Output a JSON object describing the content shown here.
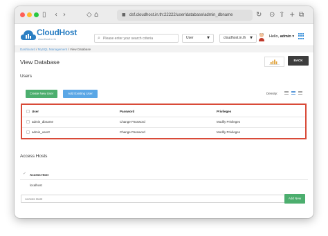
{
  "browser": {
    "url": "dsf.cloudhost.in.th:22222/user/database/admin_dbname",
    "traffic_lights": [
      "close",
      "minimize",
      "zoom"
    ],
    "icons": [
      "sidebar-icon",
      "back-icon",
      "forward-icon",
      "privacy-shield-icon",
      "home-icon",
      "refresh-icon",
      "download-icon",
      "share-icon",
      "new-tab-icon",
      "tabs-overview-icon"
    ]
  },
  "header": {
    "logo_text": "CloudHost",
    "logo_subtext": "cloudhost.in.th",
    "search_placeholder": "Please enter your search criteria",
    "user_select": "User",
    "domain_select": "cloudhost.in.th",
    "greeting": "Hello,",
    "username": "admin"
  },
  "breadcrumb": {
    "items": [
      "Dashboard",
      "MySQL Management"
    ],
    "current": "View Database"
  },
  "page": {
    "title": "View Database",
    "back_label": "BACK"
  },
  "users": {
    "section_title": "Users",
    "create_button": "Create New User",
    "add_existing_button": "Add Existing User",
    "density_label": "Density:",
    "columns": [
      "User",
      "Password",
      "Privileges"
    ],
    "rows": [
      {
        "user": "admin_dbname",
        "password": "Change Password",
        "privileges": "Modify Privileges"
      },
      {
        "user": "admin_user2",
        "password": "Change Password",
        "privileges": "Modify Privileges"
      }
    ]
  },
  "access_hosts": {
    "section_title": "Access Hosts",
    "column": "Access Host",
    "rows": [
      "localhost"
    ],
    "input_placeholder": "Access Host",
    "add_button": "Add New"
  },
  "colors": {
    "brand_blue": "#2b7fc3",
    "green_button": "#4cae6e",
    "blue_button": "#5aa7e6",
    "highlight_red": "#d94a38",
    "back_button": "#3d3d3d"
  }
}
